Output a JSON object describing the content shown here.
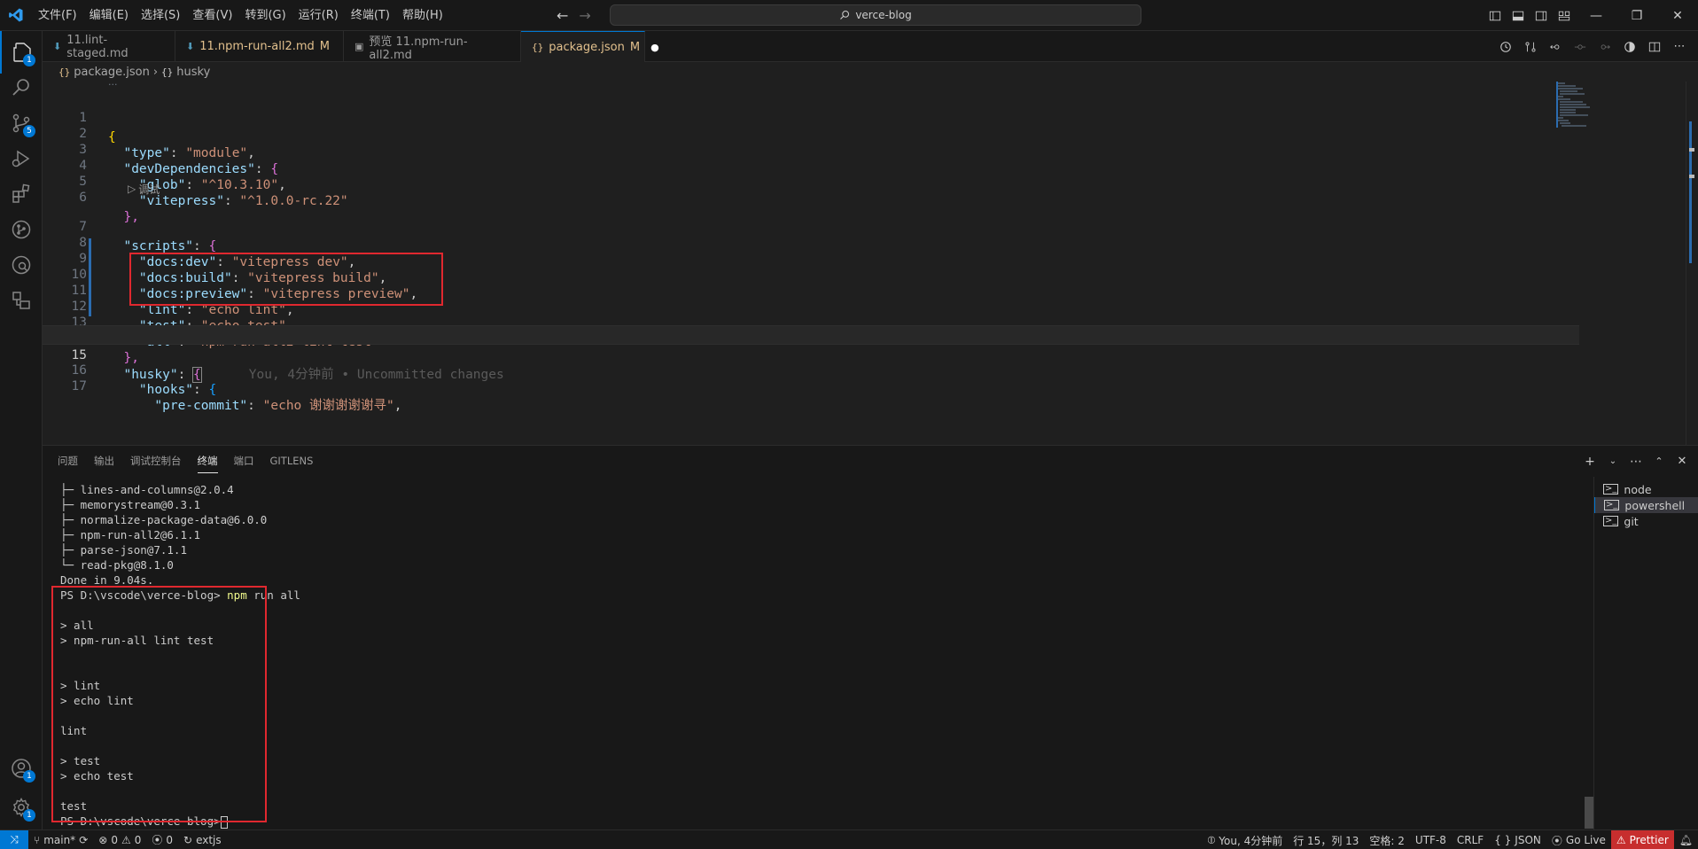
{
  "menu": [
    "文件(F)",
    "编辑(E)",
    "选择(S)",
    "查看(V)",
    "转到(G)",
    "运行(R)",
    "终端(T)",
    "帮助(H)"
  ],
  "search": {
    "text": "verce-blog"
  },
  "activity": {
    "explorer_badge": "1",
    "scm_badge": "5",
    "account_badge": "1",
    "settings_badge": "1"
  },
  "tabs": [
    {
      "label": "11.lint-staged.md",
      "status": ""
    },
    {
      "label": "11.npm-run-all2.md",
      "status": "M"
    },
    {
      "label": "预览 11.npm-run-all2.md",
      "status": ""
    },
    {
      "label": "package.json",
      "status": "M"
    }
  ],
  "breadcrumb": {
    "file": "package.json",
    "symbol": "husky"
  },
  "codelens": {
    "debug": "调试"
  },
  "code": {
    "l1": "{",
    "l2_key": "\"type\"",
    "l2_val": "\"module\"",
    "l3_key": "\"devDependencies\"",
    "l4_key": "\"glob\"",
    "l4_val": "\"^10.3.10\"",
    "l5_key": "\"vitepress\"",
    "l5_val": "\"^1.0.0-rc.22\"",
    "l6": "},",
    "l7_key": "\"scripts\"",
    "l8_key": "\"docs:dev\"",
    "l8_val": "\"vitepress dev\"",
    "l9_key": "\"docs:build\"",
    "l9_val": "\"vitepress build\"",
    "l10_key": "\"docs:preview\"",
    "l10_val": "\"vitepress preview\"",
    "l11_key": "\"lint\"",
    "l11_val": "\"echo lint\"",
    "l12_key": "\"test\"",
    "l12_val": "\"echo test\"",
    "l13_key": "\"all\"",
    "l13_val": "\"npm-run-all2 lint test\"",
    "l14": "},",
    "l15_key": "\"husky\"",
    "l15_blame": "You, 4分钟前 • Uncommitted changes",
    "l16_key": "\"hooks\"",
    "l17_key": "\"pre-commit\"",
    "l17_val": "\"echo 谢谢谢谢谢寻\""
  },
  "line_numbers": [
    "1",
    "2",
    "3",
    "4",
    "5",
    "6",
    "7",
    "8",
    "9",
    "10",
    "11",
    "12",
    "13",
    "14",
    "15",
    "16",
    "17"
  ],
  "panel": {
    "tabs": [
      "问题",
      "输出",
      "调试控制台",
      "终端",
      "端口",
      "GITLENS"
    ],
    "terminal_lines": [
      "├─ lines-and-columns@2.0.4",
      "├─ memorystream@0.3.1",
      "├─ normalize-package-data@6.0.0",
      "├─ npm-run-all2@6.1.1",
      "├─ parse-json@7.1.1",
      "└─ read-pkg@8.1.0",
      "Done in 9.04s."
    ],
    "prompt": "PS D:\\vscode\\verce-blog>",
    "command_bin": "npm",
    "command_args": " run all",
    "output": [
      "> all",
      "> npm-run-all lint test",
      "> lint",
      "> echo lint",
      "lint",
      "> test",
      "> echo test",
      "test"
    ],
    "terminals": [
      "node",
      "powershell",
      "git"
    ]
  },
  "status": {
    "branch": "main*",
    "errors": "0",
    "warnings": "0",
    "ports": "0",
    "extjs": "extjs",
    "blame": "You, 4分钟前",
    "position": "行 15，列 13",
    "spaces": "空格: 2",
    "encoding": "UTF-8",
    "eol": "CRLF",
    "language": "JSON",
    "golive": "Go Live",
    "prettier": "Prettier"
  }
}
